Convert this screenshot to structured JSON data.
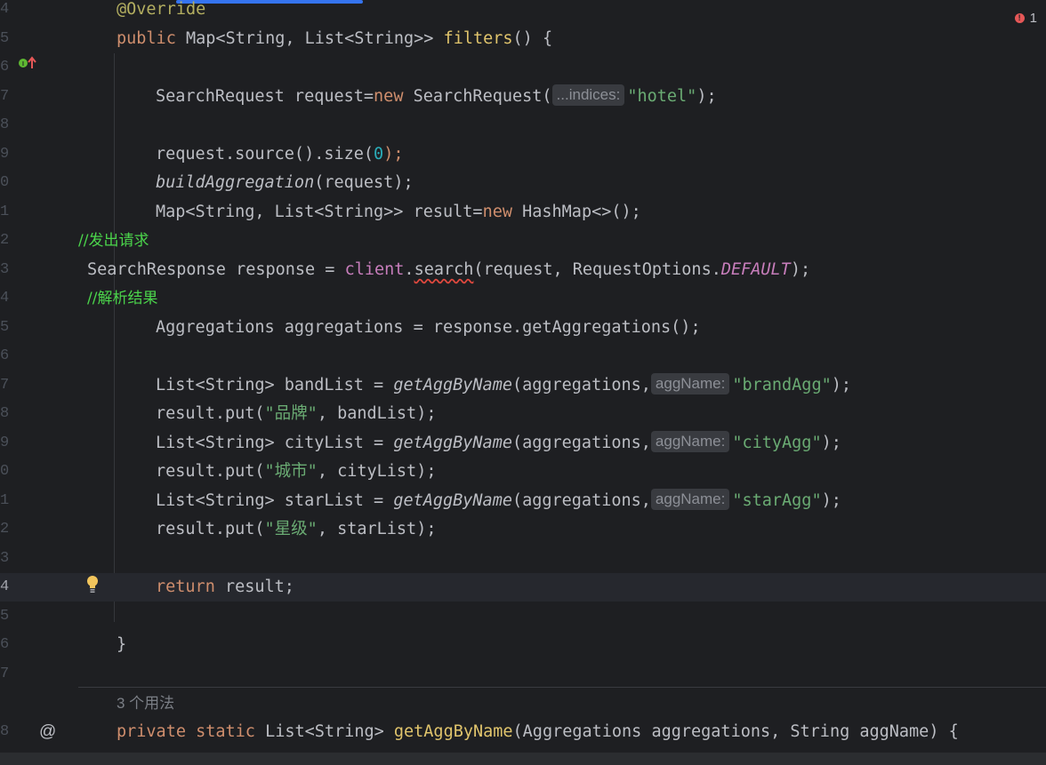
{
  "editor": {
    "line_numbers": [
      "4",
      "5",
      "6",
      "7",
      "8",
      "9",
      "0",
      "1",
      "2",
      "3",
      "4",
      "5",
      "6",
      "7",
      "8",
      "9",
      "0",
      "1",
      "2",
      "3",
      "4",
      "5",
      "6",
      "7",
      "8"
    ],
    "error_count": "1",
    "usages_label": "3 个用法",
    "hints": {
      "indices": "...indices:",
      "aggName_brand": "aggName:",
      "aggName_city": "aggName:",
      "aggName_star": "aggName:"
    },
    "code": {
      "l_override": "@Override",
      "l_public": "public",
      "l_map_sig": " Map<String, List<String>> ",
      "l_filters": "filters",
      "l_filters_tail": "() {",
      "l_sr_a": "SearchRequest request=",
      "l_new": "new",
      "l_sr_b": " SearchRequest(",
      "l_hotel": "\"hotel\"",
      "l_sr_end": ");",
      "l_req_size_a": "request.source().size(",
      "l_zero": "0",
      "l_req_size_b": ");",
      "l_build": "buildAggregation",
      "l_build_b": "(request);",
      "l_map_a": "Map<String, List<String>> result=",
      "l_new2": "new",
      "l_map_b": " HashMap<>();",
      "l_cm1": "//发出请求",
      "l_resp_a": "SearchResponse response = ",
      "l_client": "client",
      "l_dot": ".",
      "l_search": "search",
      "l_resp_b": "(request, RequestOptions.",
      "l_default": "DEFAULT",
      "l_resp_c": ");",
      "l_cm2": "//解析结果",
      "l_aggs": "Aggregations aggregations = response.getAggregations();",
      "l_brand_a": "List<String> bandList = ",
      "l_getagg1": "getAggByName",
      "l_brand_b": "(aggregations,",
      "l_brand_str": "\"brandAgg\"",
      "l_brand_end": ");",
      "l_put1_a": "result.put(",
      "l_put1_str": "\"品牌\"",
      "l_put1_b": ", bandList);",
      "l_city_a": "List<String> cityList = ",
      "l_getagg2": "getAggByName",
      "l_city_b": "(aggregations,",
      "l_city_str": "\"cityAgg\"",
      "l_city_end": ");",
      "l_put2_a": "result.put(",
      "l_put2_str": "\"城市\"",
      "l_put2_b": ", cityList);",
      "l_star_a": "List<String> starList = ",
      "l_getagg3": "getAggByName",
      "l_star_b": "(aggregations,",
      "l_star_str": "\"starAgg\"",
      "l_star_end": ");",
      "l_put3_a": "result.put(",
      "l_put3_str": "\"星级\"",
      "l_put3_b": ", starList);",
      "l_return": "return",
      "l_return_b": " result;",
      "l_close": "}",
      "l_private": "private",
      "l_static": "static",
      "l_priv_a": " List<String> ",
      "l_getagg_def": "getAggByName",
      "l_priv_b": "(Aggregations aggregations, String aggName) {"
    }
  },
  "icons": [
    "override-method-icon",
    "lightbulb-icon",
    "at-icon",
    "error-icon"
  ],
  "colors": {
    "keyword": "#cf8e6d",
    "string": "#6aab73",
    "method": "#56a8f5",
    "comment": "#4bd44b",
    "accent": "#3574f0"
  }
}
